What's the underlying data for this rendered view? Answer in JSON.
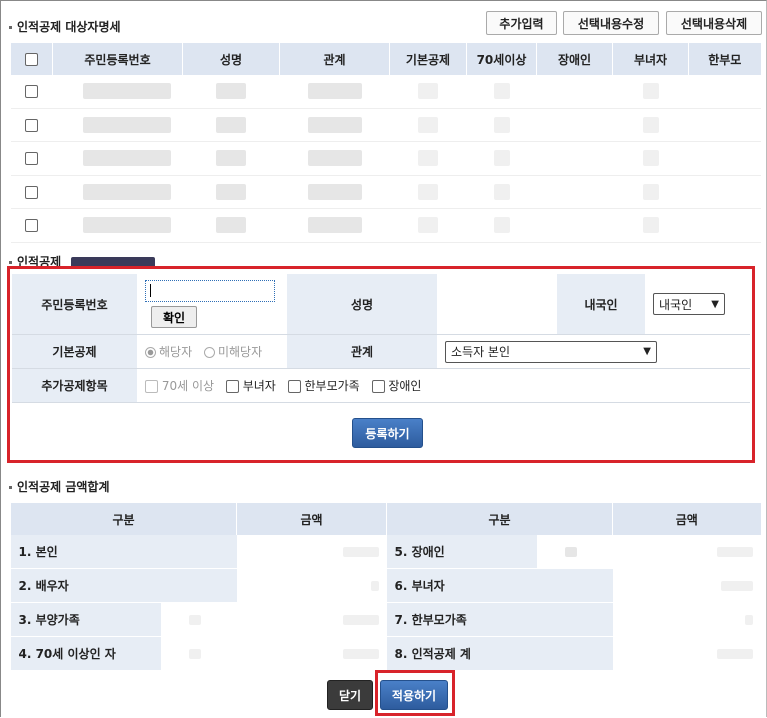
{
  "section1": {
    "title": "인적공제 대상자명세",
    "buttons": [
      "추가입력",
      "선택내용수정",
      "선택내용삭제"
    ],
    "columns": [
      "주민등록번호",
      "성명",
      "관계",
      "기본공제",
      "70세이상",
      "장애인",
      "부녀자",
      "한부모"
    ],
    "row_count": 5
  },
  "section2": {
    "title": "인적공제",
    "labels": {
      "resident_number": "주민등록번호",
      "name": "성명",
      "nationality": "내국인",
      "basic": "기본공제",
      "relation": "관계",
      "extra": "추가공제항목"
    },
    "confirm_button": "확인",
    "nationality_value": "내국인",
    "basic_options": [
      "해당자",
      "미해당자"
    ],
    "relation_value": "소득자 본인",
    "extra_options": [
      "70세 이상",
      "부녀자",
      "한부모가족",
      "장애인"
    ],
    "register_button": "등록하기"
  },
  "section3": {
    "title": "인적공제 금액합계",
    "headers": [
      "구분",
      "금액",
      "구분",
      "금액"
    ],
    "left_rows": [
      "1. 본인",
      "2. 배우자",
      "3. 부양가족",
      "4. 70세 이상인 자"
    ],
    "right_rows": [
      "5. 장애인",
      "6. 부녀자",
      "7. 한부모가족",
      "8. 인적공제 계"
    ]
  },
  "footer": {
    "close_button": "닫기",
    "apply_button": "적용하기"
  },
  "colors": {
    "header_bg": "#dde5f1",
    "label_bg": "#e7edf5",
    "highlight": "#d8232a",
    "primary_button": "#3d6fb3"
  }
}
